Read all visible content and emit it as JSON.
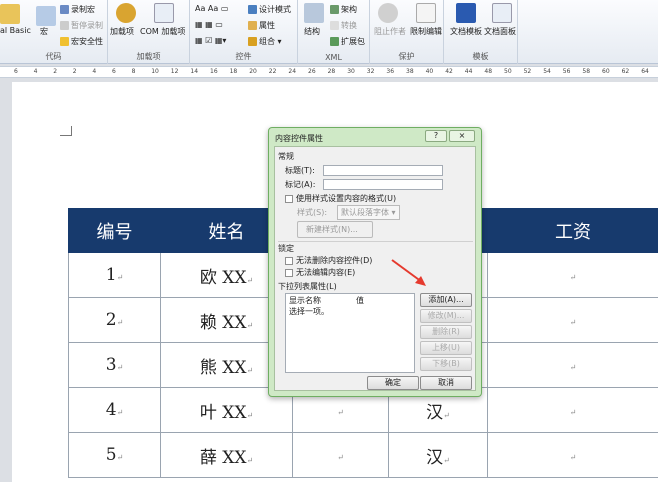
{
  "ribbon": {
    "groups": [
      {
        "label": "代码",
        "items": [
          "al Basic",
          "宏",
          "录制宏",
          "暂停录制",
          "宏安全性"
        ]
      },
      {
        "label": "加载项",
        "items": [
          "加载项",
          "COM 加载项"
        ]
      },
      {
        "label": "控件",
        "items": [
          "设计模式",
          "属性",
          "组合"
        ]
      },
      {
        "label": "XML",
        "items": [
          "结构",
          "架构",
          "转换",
          "扩展包"
        ]
      },
      {
        "label": "保护",
        "items": [
          "阻止作者",
          "限制编辑"
        ]
      },
      {
        "label": "模板",
        "items": [
          "文档模板",
          "文档面板"
        ]
      }
    ]
  },
  "ruler": [
    "6",
    "4",
    "2",
    "2",
    "4",
    "6",
    "8",
    "10",
    "12",
    "14",
    "16",
    "18",
    "20",
    "22",
    "24",
    "26",
    "28",
    "30",
    "32",
    "36",
    "38",
    "40",
    "42",
    "44",
    "48",
    "50",
    "52",
    "54",
    "56",
    "58",
    "60",
    "62",
    "64"
  ],
  "table": {
    "headers": [
      "编号",
      "姓名",
      "",
      "",
      "工资"
    ],
    "rows": [
      [
        "1",
        "欧 XX",
        "",
        "",
        ""
      ],
      [
        "2",
        "赖 XX",
        "",
        "",
        ""
      ],
      [
        "3",
        "熊 XX",
        "",
        "",
        ""
      ],
      [
        "4",
        "叶 XX",
        "",
        "汉",
        ""
      ],
      [
        "5",
        "薛 XX",
        "",
        "汉",
        ""
      ]
    ]
  },
  "dialog": {
    "title": "内容控件属性",
    "help": "?",
    "close": "⨯",
    "general": "常规",
    "title_label": "标题(T):",
    "tag_label": "标记(A):",
    "title_value": "",
    "tag_value": "",
    "use_style": "使用样式设置内容的格式(U)",
    "style_label": "样式(S):",
    "style_value": "默认段落字体",
    "new_style": "新建样式(N)...",
    "locking": "锁定",
    "no_delete": "无法删除内容控件(D)",
    "no_edit": "无法编辑内容(E)",
    "dropdown_props": "下拉列表属性(L)",
    "col_display": "显示名称",
    "col_value": "值",
    "list_items": [
      "选择一项。"
    ],
    "add": "添加(A)...",
    "modify": "修改(M)...",
    "remove": "删除(R)",
    "up": "上移(U)",
    "down": "下移(B)",
    "ok": "确定",
    "cancel": "取消"
  },
  "colors": {
    "header": "#173a6d",
    "arrow": "#e53a2e",
    "dialog": "#cfe9c6"
  }
}
